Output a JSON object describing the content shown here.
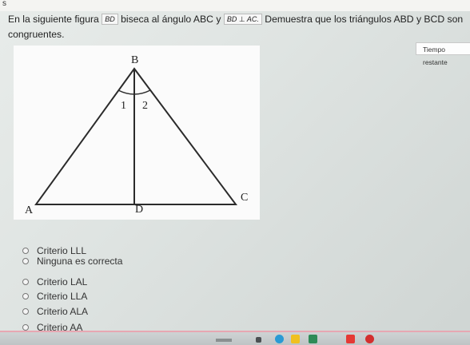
{
  "question": {
    "part1": "En la siguiente figura",
    "seg_bd": "BD",
    "part2": "biseca al ángulo ABC y",
    "perp": "BD ⊥ AC.",
    "part3": "Demuestra que los triángulos ABD y BCD son congruentes."
  },
  "figure": {
    "label_b": "B",
    "label_a": "A",
    "label_c": "C",
    "label_d": "D",
    "angle_1": "1",
    "angle_2": "2"
  },
  "timer": {
    "label": "Tiempo restante"
  },
  "options": [
    {
      "label": "Criterio LLL"
    },
    {
      "label": "Ninguna es correcta"
    },
    {
      "label": "Criterio LAL"
    },
    {
      "label": "Criterio LLA"
    },
    {
      "label": "Criterio ALA"
    },
    {
      "label": "Criterio AA"
    }
  ],
  "taskbar": {
    "icons": [
      "dock-icon",
      "folder-icon",
      "chrome-icon",
      "files-icon",
      "classroom-icon",
      "music-icon",
      "pinterest-icon"
    ],
    "colors": {
      "chrome": "#2a9ad4",
      "files": "#f0c020",
      "classroom": "#2e8b57",
      "music": "#e53935",
      "pinterest": "#d32f2f"
    }
  }
}
